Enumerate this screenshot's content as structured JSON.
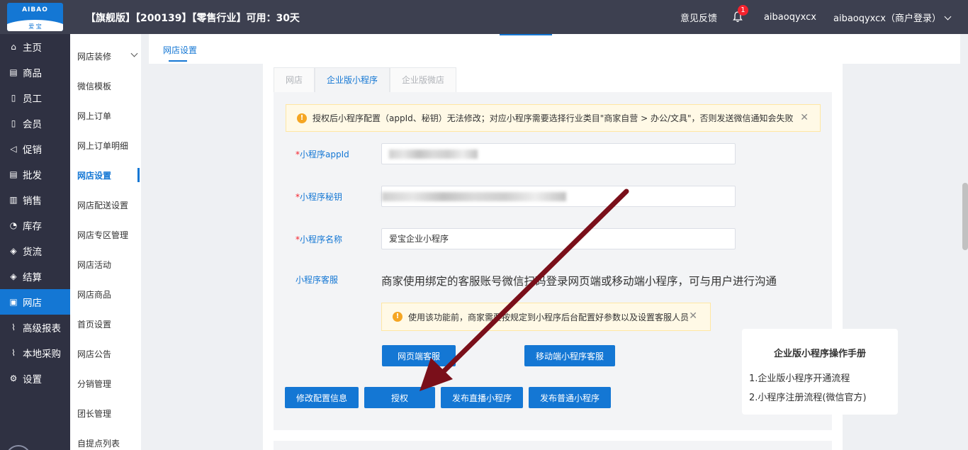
{
  "topbar": {
    "logo_top": "AIBAO",
    "logo_bottom": "爱 宝",
    "version": "【旗舰版】【200139】【零售行业】可用：30天",
    "feedback": "意见反馈",
    "notifications": "1",
    "user": "aibaoqyxcx",
    "account": "aibaoqyxcx（商户登录）"
  },
  "nav": {
    "items": [
      {
        "label": "主页",
        "icon": "home-icon"
      },
      {
        "label": "商品",
        "icon": "goods-icon"
      },
      {
        "label": "员工",
        "icon": "staff-icon"
      },
      {
        "label": "会员",
        "icon": "member-icon"
      },
      {
        "label": "促销",
        "icon": "promo-icon"
      },
      {
        "label": "批发",
        "icon": "wholesale-icon"
      },
      {
        "label": "销售",
        "icon": "sales-icon"
      },
      {
        "label": "库存",
        "icon": "stock-icon"
      },
      {
        "label": "货流",
        "icon": "flow-icon"
      },
      {
        "label": "结算",
        "icon": "settle-icon"
      },
      {
        "label": "网店",
        "icon": "shop-icon"
      },
      {
        "label": "高级报表",
        "icon": "report-icon"
      },
      {
        "label": "本地采购",
        "icon": "purchase-icon"
      },
      {
        "label": "设置",
        "icon": "gear-icon"
      }
    ]
  },
  "subnav": {
    "items": [
      "网店装修",
      "微信模板",
      "网上订单",
      "网上订单明细",
      "网店设置",
      "网店配送设置",
      "网店专区管理",
      "网店活动",
      "网店商品",
      "首页设置",
      "网店公告",
      "分销管理",
      "团长管理",
      "自提点列表"
    ]
  },
  "page": {
    "tab": "网店设置",
    "tabs": [
      "网店",
      "企业版小程序",
      "企业版微店"
    ]
  },
  "form": {
    "notice": "授权后小程序配置（appId、秘钥）无法修改；对应小程序需要选择行业类目\"商家自营 > 办公/文具\"，否则发送微信通知会失败",
    "appid_label": "小程序appId",
    "secret_label": "小程序秘钥",
    "name_label": "小程序名称",
    "name_value": "爱宝企业小程序",
    "cs_label": "小程序客服",
    "cs_text": "商家使用绑定的客服账号微信扫码登录网页端或移动端小程序，可与用户进行沟通",
    "cs_notice": "使用该功能前，商家需要按规定到小程序后台配置好参数以及设置客服人员",
    "required_mark": "*"
  },
  "buttons": {
    "web_cs": "网页端客服",
    "mobile_cs": "移动端小程序客服",
    "modify": "修改配置信息",
    "authorize": "授权",
    "publish_live": "发布直播小程序",
    "publish_normal": "发布普通小程序"
  },
  "manual": {
    "title": "企业版小程序操作手册",
    "links": [
      "1.企业版小程序开通流程",
      "2.小程序注册流程(微信官方)"
    ]
  },
  "colors": {
    "primary": "#1477d4",
    "topbar": "#3d4050",
    "nav": "#2f3142",
    "arrow": "#7a0f1a"
  }
}
